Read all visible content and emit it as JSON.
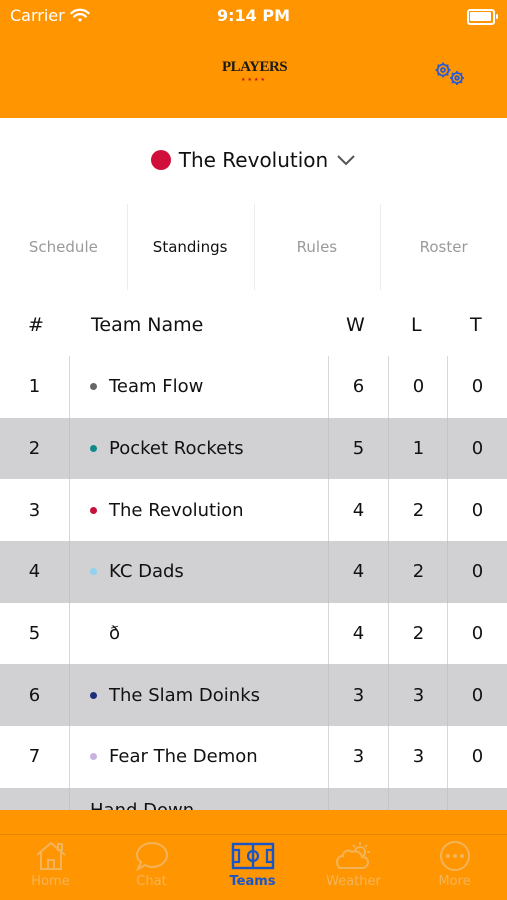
{
  "status_bar": {
    "carrier": "Carrier",
    "time": "9:14 PM"
  },
  "header": {
    "logo_text": "PLAYERS",
    "logo_stars": "★★★★",
    "settings_icon": "gear-icon"
  },
  "team_selector": {
    "name": "The Revolution",
    "color": "#d0103a"
  },
  "tabs": [
    {
      "label": "Schedule"
    },
    {
      "label": "Standings"
    },
    {
      "label": "Rules"
    },
    {
      "label": "Roster"
    }
  ],
  "active_tab": "Standings",
  "table": {
    "headers": {
      "num": "#",
      "name": "Team Name",
      "w": "W",
      "l": "L",
      "t": "T"
    },
    "rows": [
      {
        "rank": "1",
        "name": "Team Flow",
        "color": "#666666",
        "w": "6",
        "l": "0",
        "t": "0"
      },
      {
        "rank": "2",
        "name": "Pocket Rockets",
        "color": "#0f8a8a",
        "w": "5",
        "l": "1",
        "t": "0"
      },
      {
        "rank": "3",
        "name": "The Revolution",
        "color": "#c4123a",
        "w": "4",
        "l": "2",
        "t": "0"
      },
      {
        "rank": "4",
        "name": "KC Dads",
        "color": "#8fd3f0",
        "w": "4",
        "l": "2",
        "t": "0"
      },
      {
        "rank": "5",
        "name": "ð",
        "color": "",
        "w": "4",
        "l": "2",
        "t": "0"
      },
      {
        "rank": "6",
        "name": "The Slam Doinks",
        "color": "#1f2f7a",
        "w": "3",
        "l": "3",
        "t": "0"
      },
      {
        "rank": "7",
        "name": "Fear The Demon",
        "color": "#c9b2e0",
        "w": "3",
        "l": "3",
        "t": "0"
      },
      {
        "rank": "",
        "name": "Hand Down",
        "color": "",
        "w": "",
        "l": "",
        "t": ""
      }
    ]
  },
  "bottom_nav": {
    "items": [
      {
        "label": "Home",
        "icon": "home-icon"
      },
      {
        "label": "Chat",
        "icon": "chat-icon"
      },
      {
        "label": "Teams",
        "icon": "field-icon"
      },
      {
        "label": "Weather",
        "icon": "weather-icon"
      },
      {
        "label": "More",
        "icon": "more-icon"
      }
    ],
    "active": "Teams",
    "active_color": "#1a55c8",
    "inactive_color": "#f2b45a"
  },
  "colors": {
    "brand_orange": "#ff9500",
    "row_shade": "#d1d1d3"
  }
}
